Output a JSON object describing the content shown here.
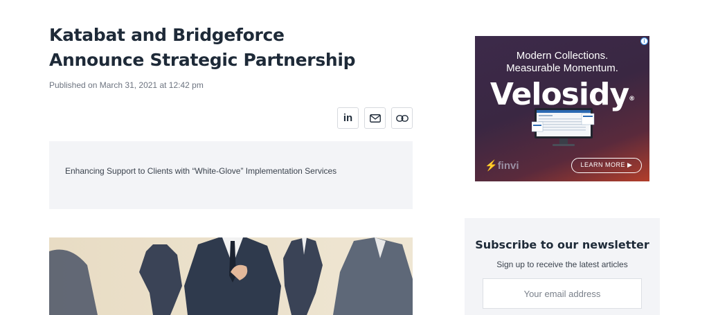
{
  "article": {
    "title": "Katabat and Bridgeforce Announce Strategic Partnership",
    "published": "Published on March 31, 2021 at 12:42 pm",
    "summary": "Enhancing Support to Clients with “White-Glove” Implementation Services"
  },
  "share": {
    "linkedin_label": "in",
    "icons": [
      "linkedin-icon",
      "mail-icon",
      "link-icon"
    ]
  },
  "ad": {
    "headline_line1": "Modern Collections.",
    "headline_line2": "Measurable Momentum.",
    "brand": "Velosidy",
    "registered": "®",
    "sponsor": "finvi",
    "cta": "LEARN MORE ▶",
    "info": "i"
  },
  "newsletter": {
    "title": "Subscribe to our newsletter",
    "subtitle": "Sign up to receive the latest articles",
    "email_placeholder": "Your email address",
    "email_value": ""
  },
  "colors": {
    "heading": "#1e2a38",
    "panel_bg": "#f3f4f7",
    "border": "#d6d9de"
  }
}
